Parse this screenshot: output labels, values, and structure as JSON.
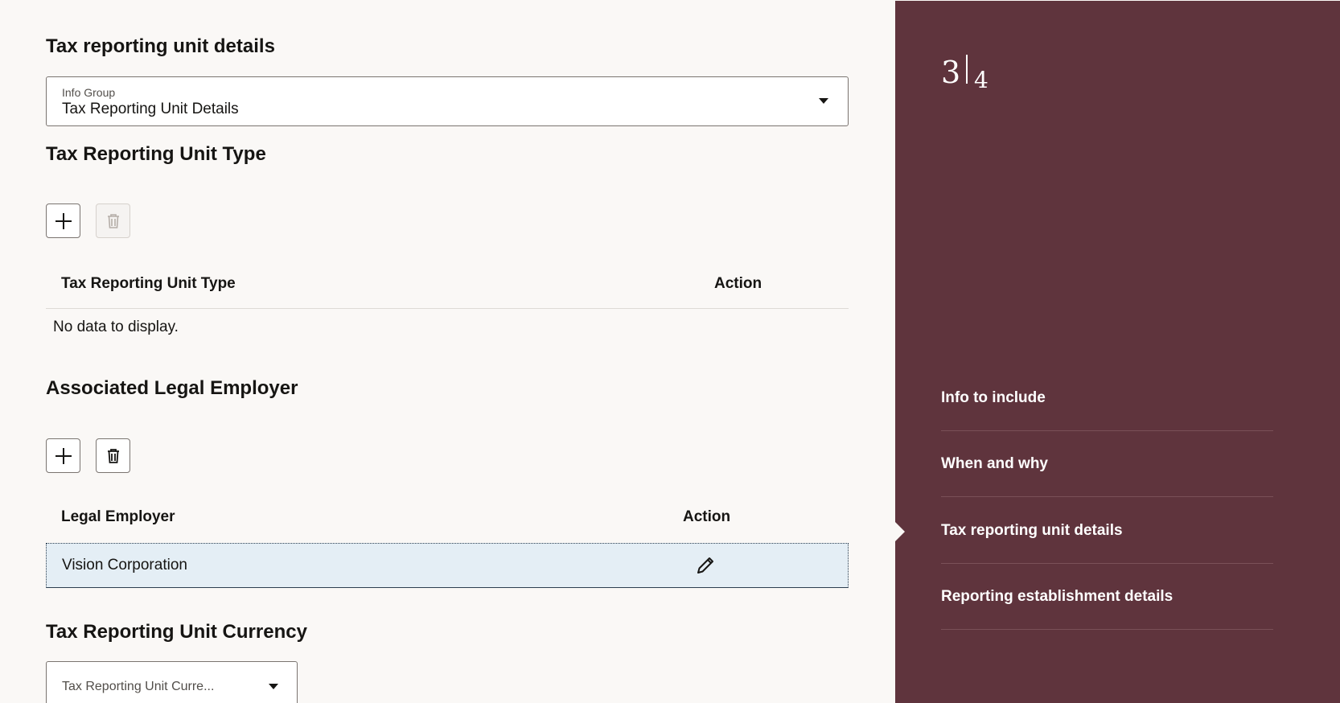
{
  "page": {
    "title": "Tax reporting unit details"
  },
  "info_group": {
    "label": "Info Group",
    "value": "Tax Reporting Unit Details"
  },
  "tru_type": {
    "heading": "Tax Reporting Unit Type",
    "columns": [
      "Tax Reporting Unit Type",
      "Action"
    ],
    "empty_text": "No data to display."
  },
  "legal_employer": {
    "heading": "Associated Legal Employer",
    "columns": [
      "Legal Employer",
      "Action"
    ],
    "rows": [
      {
        "name": "Vision Corporation"
      }
    ]
  },
  "currency": {
    "heading": "Tax Reporting Unit Currency",
    "placeholder": "Tax Reporting Unit Curre..."
  },
  "panel": {
    "current": "3",
    "total": "4",
    "nav": [
      {
        "label": "Info to include",
        "active": false
      },
      {
        "label": "When and why",
        "active": false
      },
      {
        "label": "Tax reporting unit details",
        "active": true
      },
      {
        "label": "Reporting establishment details",
        "active": false
      }
    ]
  },
  "colors": {
    "panel_bg": "#5f343d",
    "page_bg": "#faf8f6",
    "selected_row": "#e4eef5"
  },
  "icons": {
    "add": "plus-icon",
    "delete": "trash-icon",
    "edit": "pencil-icon",
    "dropdown": "chevron-down-icon"
  }
}
